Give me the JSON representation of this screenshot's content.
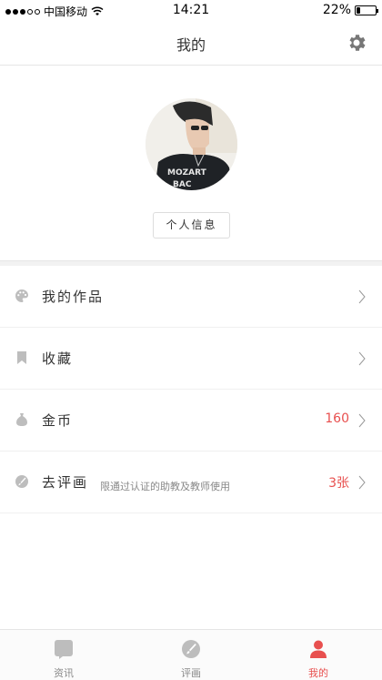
{
  "status_bar": {
    "carrier": "中国移动",
    "time": "14:21",
    "battery_percent_text": "22%",
    "battery_level": 0.22,
    "signal_bars_on": 3,
    "signal_bars_total": 5
  },
  "nav": {
    "title": "我的",
    "settings_icon": "gear-icon"
  },
  "profile": {
    "avatar_icon": "avatar-photo",
    "info_button_label": "个人信息"
  },
  "menu": {
    "items": [
      {
        "label": "我的作品",
        "icon": "palette-icon",
        "sub": "",
        "value": ""
      },
      {
        "label": "收藏",
        "icon": "bookmark-icon",
        "sub": "",
        "value": ""
      },
      {
        "label": "金币",
        "icon": "coin-bag-icon",
        "sub": "",
        "value": "160"
      },
      {
        "label": "去评画",
        "icon": "brush-circle-icon",
        "sub": "限通过认证的助教及教师使用",
        "value": "3张"
      }
    ]
  },
  "tab_bar": {
    "tabs": [
      {
        "label": "资讯",
        "icon": "news-icon",
        "active": false
      },
      {
        "label": "评画",
        "icon": "review-icon",
        "active": false
      },
      {
        "label": "我的",
        "icon": "user-icon",
        "active": true
      }
    ]
  },
  "colors": {
    "accent": "#e8504f",
    "icon_gray": "#bdbdbd",
    "text": "#333333"
  }
}
